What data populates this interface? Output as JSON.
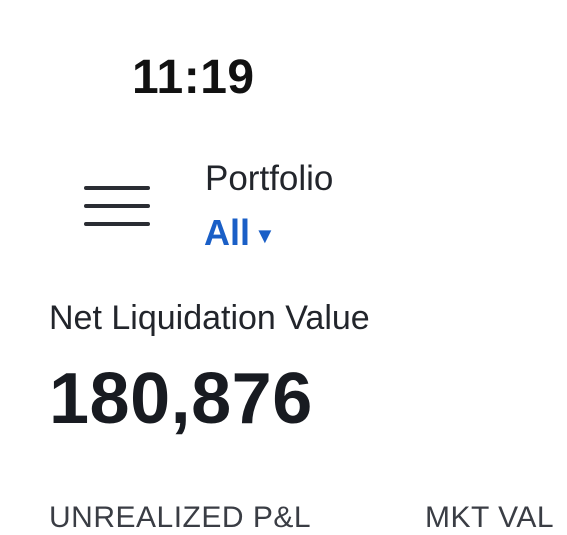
{
  "status_bar": {
    "time": "11:19"
  },
  "header": {
    "portfolio_label": "Portfolio",
    "portfolio_selected": "All",
    "caret_icon": "caret-down-icon",
    "menu_icon": "hamburger-menu-icon"
  },
  "summary": {
    "net_liquidation_label": "Net Liquidation Value",
    "net_liquidation_value": "180,876"
  },
  "columns": {
    "unrealized_pnl": "UNREALIZED P&L",
    "market_value": "MKT VAL"
  },
  "colors": {
    "accent": "#1a5fc7",
    "text_primary": "#181b21"
  }
}
